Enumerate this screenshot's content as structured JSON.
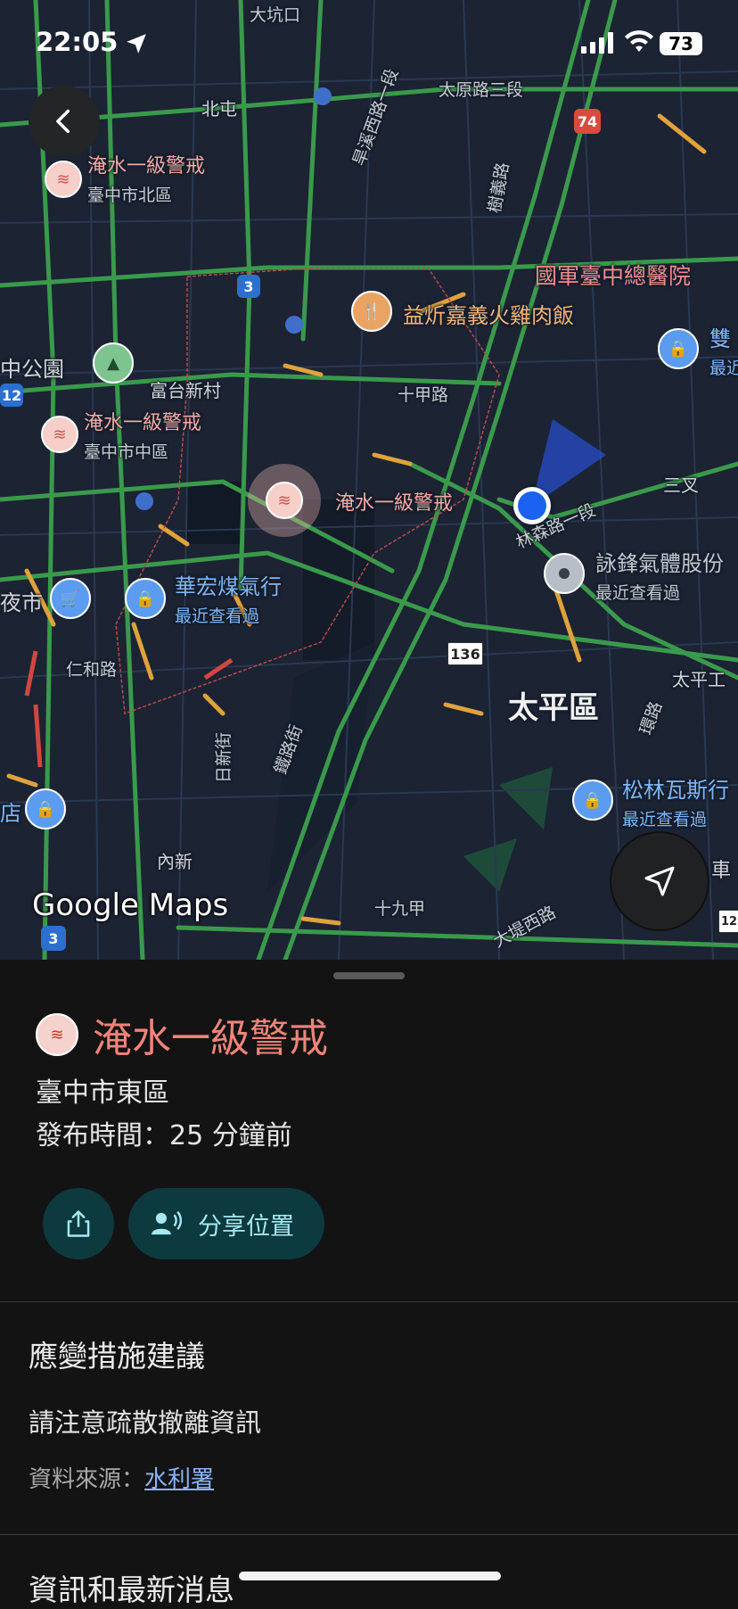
{
  "status_bar": {
    "time": "22:05",
    "battery": "73"
  },
  "map": {
    "labels": {
      "dakengkou": "大坑口",
      "beitun": "北屯",
      "taiyuan": "太原路三段",
      "hanxi": "旱溪西路一段",
      "shuyi": "樹義路",
      "fugu": "富台新村",
      "shijia": "十甲路",
      "sancha": "三叉",
      "ren_he": "仁和路",
      "rixin": "日新街",
      "tielu": "鐵路街",
      "neixin": "內新",
      "shijiujia": "十九甲",
      "dadi": "大堤西路",
      "taiping": "太平區",
      "taiping_gong": "太平工",
      "lin_sen": "林森路一段",
      "yeshi": "夜市",
      "zhong_park": "中公園",
      "shop_edge": "店",
      "che": "車",
      "guan_road": "環路",
      "shuang": "雙",
      "recent_short": "最近"
    },
    "warnings": [
      {
        "title": "淹水一級警戒",
        "sub": "臺中市北區"
      },
      {
        "title": "淹水一級警戒",
        "sub": "臺中市中區"
      },
      {
        "title": "淹水一級警戒",
        "sub": ""
      }
    ],
    "pois": {
      "food": "益炘嘉義火雞肉飯",
      "hospital": "國軍臺中總醫院",
      "gas1": {
        "name": "華宏煤氣行",
        "sub": "最近查看過"
      },
      "gas2": {
        "name": "詠鋒氣體股份",
        "sub": "最近查看過"
      },
      "gas3": {
        "name": "松林瓦斯行",
        "sub": "最近查看過"
      }
    },
    "shields": [
      "74",
      "3",
      "12",
      "136",
      "3",
      "12"
    ],
    "logo": "Google Maps"
  },
  "sheet": {
    "title": "淹水一級警戒",
    "district": "臺中市東區",
    "published": "發布時間：25 分鐘前",
    "share_location_label": "分享位置",
    "section1_title": "應變措施建議",
    "section1_body": "請注意疏散撤離資訊",
    "source_prefix": "資料來源：",
    "source_link": "水利署",
    "section2_title": "資訊和最新消息"
  }
}
